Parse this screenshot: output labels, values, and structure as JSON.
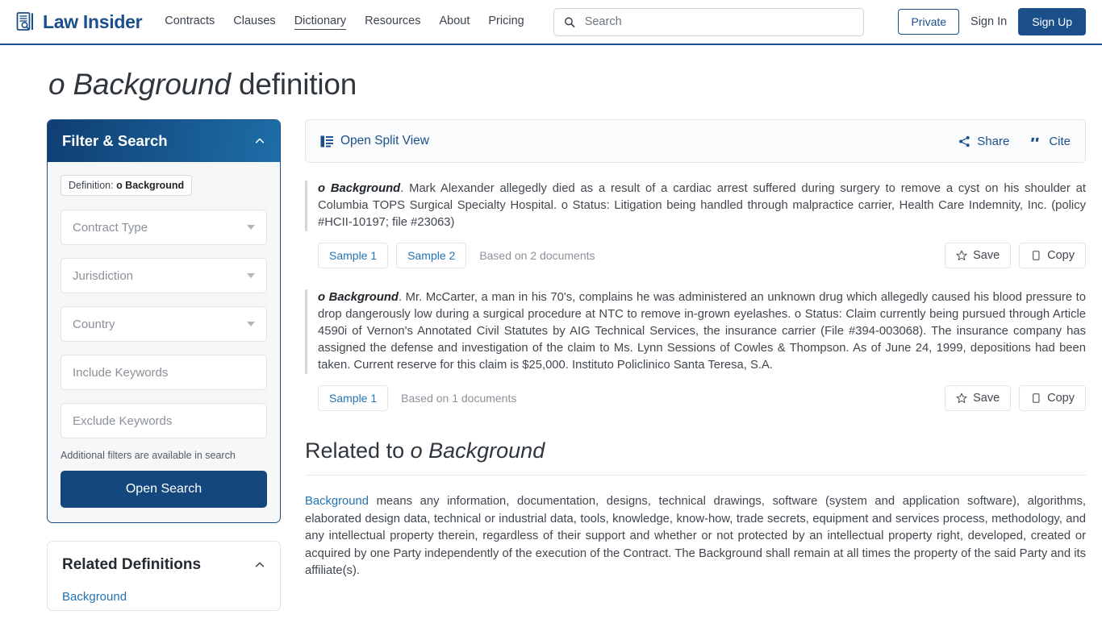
{
  "header": {
    "logo_text": "Law Insider",
    "logo_icon": "document-search-icon",
    "nav": [
      {
        "label": "Contracts",
        "active": false
      },
      {
        "label": "Clauses",
        "active": false
      },
      {
        "label": "Dictionary",
        "active": true
      },
      {
        "label": "Resources",
        "active": false
      },
      {
        "label": "About",
        "active": false
      },
      {
        "label": "Pricing",
        "active": false
      }
    ],
    "search": {
      "placeholder": "Search",
      "value": "",
      "icon": "search-icon"
    },
    "private_label": "Private",
    "signin_label": "Sign In",
    "signup_label": "Sign Up"
  },
  "page": {
    "title_term": "o Background",
    "title_suffix": " definition"
  },
  "sidebar": {
    "filter_card": {
      "title": "Filter & Search",
      "collapse_icon": "chevron-up-icon",
      "chip_prefix": "Definition: ",
      "chip_term": "o Background",
      "fields": [
        {
          "placeholder": "Contract Type",
          "name": "contract-type"
        },
        {
          "placeholder": "Jurisdiction",
          "name": "jurisdiction"
        },
        {
          "placeholder": "Country",
          "name": "country"
        },
        {
          "placeholder": "Include Keywords",
          "name": "include-keywords"
        },
        {
          "placeholder": "Exclude Keywords",
          "name": "exclude-keywords"
        }
      ],
      "note": "Additional filters are available in search",
      "open_search_label": "Open Search"
    },
    "related_card": {
      "title": "Related Definitions",
      "collapse_icon": "chevron-up-icon",
      "links": [
        "Background"
      ]
    }
  },
  "main": {
    "toolbar": {
      "split_view_label": "Open Split View",
      "split_view_icon": "split-view-icon",
      "share_label": "Share",
      "share_icon": "share-icon",
      "cite_label": "Cite",
      "cite_icon": "quote-icon"
    },
    "definitions": [
      {
        "term": "o Background",
        "body": ". Mark Alexander allegedly died as a result of a cardiac arrest suffered during surgery to remove a cyst on his shoulder at Columbia TOPS Surgical Specialty Hospital. o Status: Litigation being handled through malpractice carrier, Health Care Indemnity, Inc. (policy #HCII-10197; file #23063)",
        "samples": [
          "Sample 1",
          "Sample 2"
        ],
        "based_on": "Based on 2 documents",
        "save_label": "Save",
        "copy_label": "Copy"
      },
      {
        "term": "o Background",
        "body": ". Mr. McCarter, a man in his 70's, complains he was administered an unknown drug which allegedly caused his blood pressure to drop dangerously low during a surgical procedure at NTC to remove in-grown eyelashes. o Status: Claim currently being pursued through Article 4590i of Vernon's Annotated Civil Statutes by AIG Technical Services, the insurance carrier (File #394-003068). The insurance company has assigned the defense and investigation of the claim to Ms. Lynn Sessions of Cowles & Thompson. As of June 24, 1999, depositions had been taken. Current reserve for this claim is $25,000. Instituto Policlinico Santa Teresa, S.A.",
        "samples": [
          "Sample 1"
        ],
        "based_on": "Based on 1 documents",
        "save_label": "Save",
        "copy_label": "Copy"
      }
    ],
    "related_section": {
      "heading_prefix": "Related to ",
      "heading_term": "o Background",
      "entry_link": "Background",
      "entry_body": " means any information, documentation, designs, technical drawings, software (system and application software), algorithms, elaborated design data, technical or industrial data, tools, knowledge, know-how, trade secrets, equipment and services process, methodology, and any intellectual property therein, regardless of their support and whether or not protected by an intellectual property right, developed, created or acquired by one Party independently of the execution of the Contract. The Background shall remain at all times the property of the said Party and its affiliate(s)."
    }
  },
  "colors": {
    "brand_blue": "#1b4f8a",
    "link_blue": "#2273b5",
    "button_blue": "#13477e",
    "text": "#41474e"
  }
}
